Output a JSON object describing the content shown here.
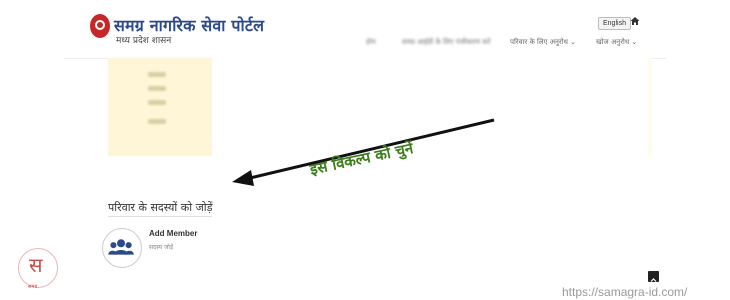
{
  "header": {
    "title": "समग्र नागरिक सेवा पोर्टल",
    "subtitle": "मध्य प्रदेश शासन",
    "language_button": "English",
    "nav_items": [
      {
        "label": "होम"
      },
      {
        "label": "समग्र आईडी के लिए पंजीकरण करें"
      },
      {
        "label": "परिवार के लिए अनुरोध ⌄"
      },
      {
        "label": "खोज अनुरोध ⌄"
      }
    ]
  },
  "annotation": {
    "instruction": "इस विकल्प को चुनें",
    "arrow_color": "#111111",
    "text_color": "#3a7d1a"
  },
  "section": {
    "title": "परिवार के सदस्यों को जोड़ें",
    "card": {
      "title": "Add Member",
      "subtitle": "सदस्य जोड़ें",
      "icon": "users-icon"
    }
  },
  "footer": {
    "logo_glyph": "स",
    "logo_label": "समग्र",
    "url": "https://samagra-id.com/"
  },
  "colors": {
    "brand_blue": "#2b4a8b",
    "logo_red": "#c62828",
    "panel_yellow": "#fff6d8"
  }
}
